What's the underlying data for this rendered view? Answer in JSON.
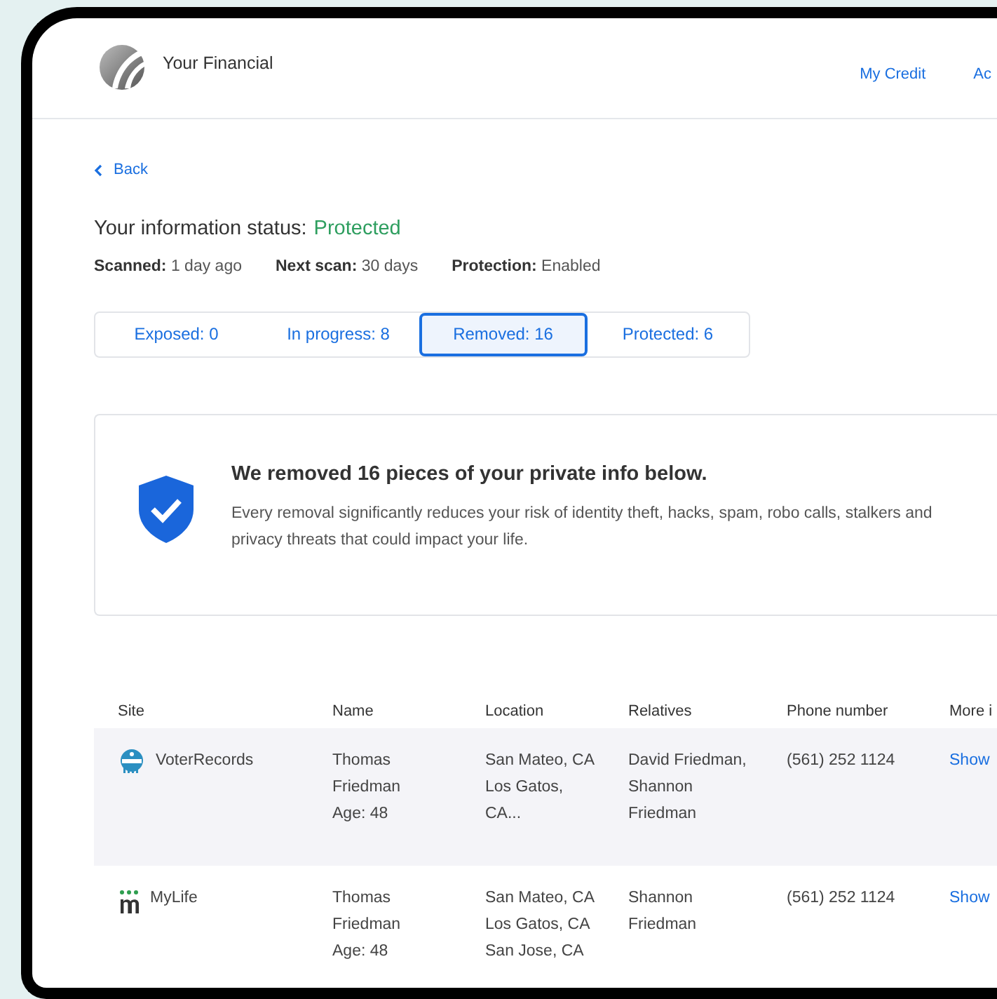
{
  "header": {
    "brand": "Your Financial",
    "nav": [
      {
        "label": "My Credit"
      },
      {
        "label": "Ac"
      }
    ]
  },
  "back": {
    "label": "Back"
  },
  "status": {
    "label": "Your information status:",
    "value": "Protected"
  },
  "meta": [
    {
      "label": "Scanned:",
      "value": "1 day ago"
    },
    {
      "label": "Next scan:",
      "value": "30 days"
    },
    {
      "label": "Protection:",
      "value": "Enabled"
    }
  ],
  "tabs": [
    {
      "label": "Exposed: 0",
      "selected": false
    },
    {
      "label": "In progress: 8",
      "selected": false
    },
    {
      "label": "Removed: 16",
      "selected": true
    },
    {
      "label": "Protected: 6",
      "selected": false
    }
  ],
  "notice": {
    "title": "We removed 16 pieces of your private info below.",
    "body": "Every removal significantly reduces your risk of identity theft, hacks, spam, robo calls, stalkers and privacy threats that could impact your life."
  },
  "table": {
    "columns": [
      "Site",
      "Name",
      "Location",
      "Relatives",
      "Phone number",
      "More i"
    ],
    "rows": [
      {
        "site": "VoterRecords",
        "kind": "vote",
        "name": [
          "Thomas",
          "Friedman",
          "Age: 48"
        ],
        "location": [
          "San Mateo, CA",
          "Los Gatos,",
          "CA..."
        ],
        "relatives": [
          "David Friedman,",
          "Shannon",
          "Friedman"
        ],
        "phone": "(561) 252 1124",
        "more": "Show"
      },
      {
        "site": "MyLife",
        "kind": "mylife",
        "name": [
          "Thomas",
          "Friedman",
          "Age: 48"
        ],
        "location": [
          "San Mateo, CA",
          "Los Gatos, CA",
          "San Jose, CA"
        ],
        "relatives": [
          "Shannon",
          "Friedman"
        ],
        "phone": "(561) 252 1124",
        "more": "Show"
      }
    ]
  }
}
